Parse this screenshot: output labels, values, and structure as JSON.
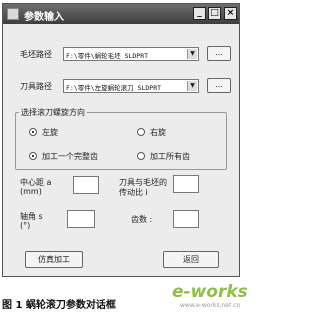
{
  "window": {
    "title": "参数输入",
    "minimize": "_",
    "maximize": "□",
    "close": "×"
  },
  "blank_path": {
    "label": "毛坯路径",
    "value": "F:\\零件\\蜗轮毛坯 SLDPRT",
    "browse": "..."
  },
  "tool_path": {
    "label": "刀具路径",
    "value": "F:\\零件\\左旋蜗轮滚刀 SLDPRT",
    "browse": "..."
  },
  "group": {
    "title": "选择滚刀螺旋方向",
    "left_hand": "左旋",
    "right_hand": "右旋",
    "one_tooth": "加工一个完整齿",
    "all_teeth": "加工所有齿",
    "selected_direction": "左旋",
    "selected_mode": "加工一个完整齿"
  },
  "params": {
    "center_distance_label": "中心距 a",
    "center_distance_unit": "(mm)",
    "ratio_label": "刀具与毛坯的",
    "ratio_label2": "传动比 i",
    "axis_angle_label": "轴角 s",
    "axis_angle_unit": "(°)",
    "teeth_label": "齿数 :",
    "center_distance_value": "",
    "ratio_value": "",
    "axis_angle_value": "",
    "teeth_value": ""
  },
  "buttons": {
    "simulate": "仿真加工",
    "back": "返回"
  },
  "caption": "图 1    蜗轮滚刀参数对话框",
  "watermark": {
    "brand": "e-works",
    "sub": "www.e-works.net.cn",
    "color": "#8fbf49"
  }
}
